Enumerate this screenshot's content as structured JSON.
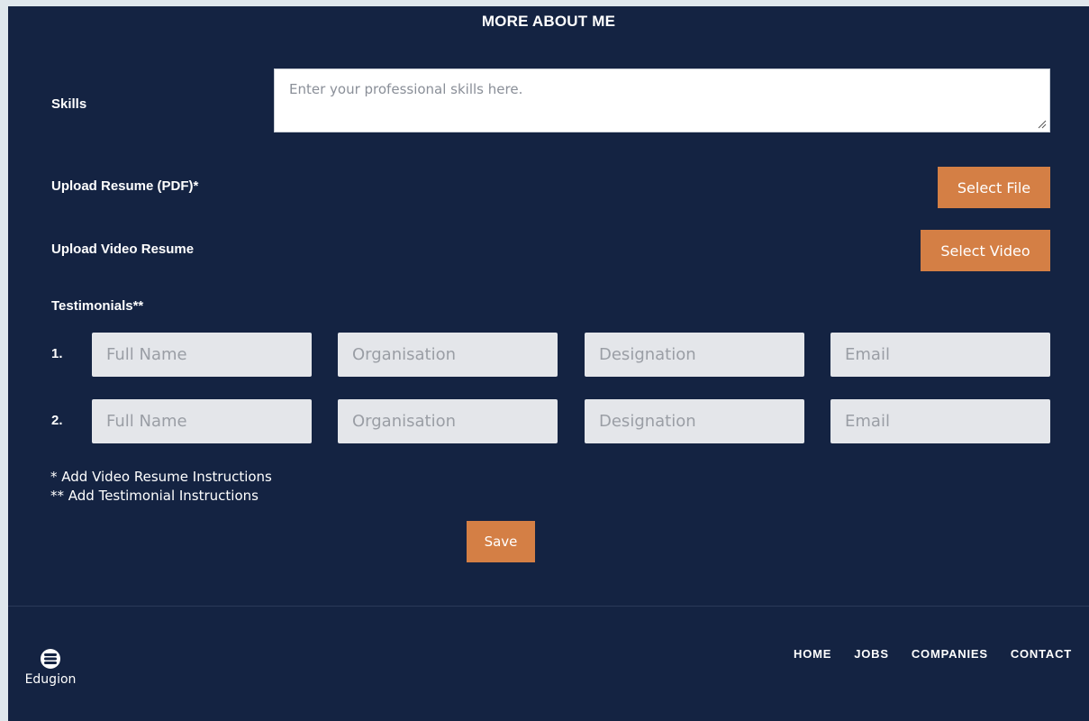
{
  "section": {
    "title": "MORE ABOUT ME"
  },
  "skills": {
    "label": "Skills",
    "placeholder": "Enter your professional skills here."
  },
  "resume": {
    "label": "Upload Resume (PDF)*",
    "button": "Select File"
  },
  "video": {
    "label": "Upload Video Resume",
    "button": "Select Video"
  },
  "testimonials": {
    "label": "Testimonials**",
    "rows": [
      {
        "num": "1.",
        "full_name": "Full Name",
        "organisation": "Organisation",
        "designation": "Designation",
        "email": "Email"
      },
      {
        "num": "2.",
        "full_name": "Full Name",
        "organisation": "Organisation",
        "designation": "Designation",
        "email": "Email"
      }
    ]
  },
  "notes": {
    "video": "* Add Video Resume Instructions",
    "testimonial": "** Add Testimonial Instructions"
  },
  "save_button": "Save",
  "footer": {
    "logo_text": "Edugion",
    "nav": [
      "HOME",
      "JOBS",
      "COMPANIES",
      "CONTACT"
    ]
  },
  "colors": {
    "panel_bg": "#142342",
    "accent": "#d47f45",
    "field_bg": "#e4e6ea"
  },
  "icons": [
    "resize-grip-icon",
    "edugion-logo-icon"
  ]
}
